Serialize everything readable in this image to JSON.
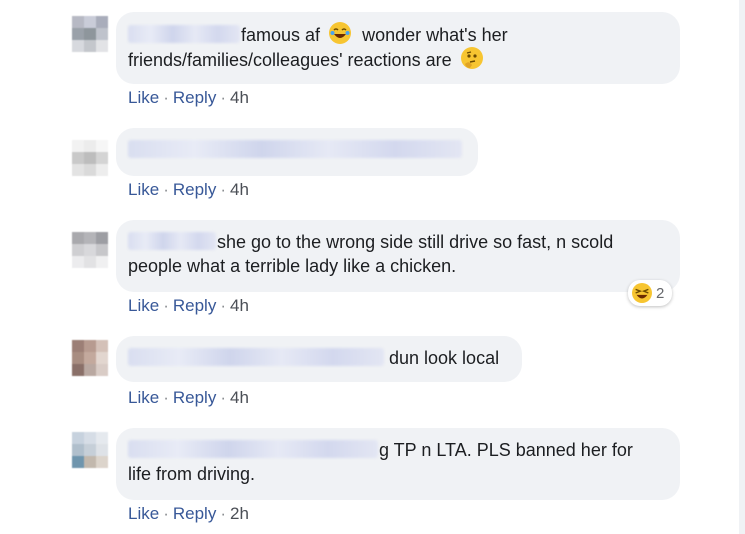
{
  "comments": [
    {
      "text_line1": "famous af",
      "text_line1b": "wonder what's her",
      "text_line2": "friends/families/colleagues' reactions are",
      "like": "Like",
      "reply": "Reply",
      "time": "4h",
      "emoji1": "laughing-tears-icon",
      "emoji2": "thinking-face-icon"
    },
    {
      "text": "",
      "like": "Like",
      "reply": "Reply",
      "time": "4h"
    },
    {
      "text_line1": "she go to the wrong side still drive so fast, n scold",
      "text_line2": "people what a terrible lady like a chicken.",
      "like": "Like",
      "reply": "Reply",
      "time": "4h",
      "reaction_icon": "laughing-face-icon",
      "reaction_count": "2"
    },
    {
      "text_line1": "dun look local",
      "like": "Like",
      "reply": "Reply",
      "time": "4h"
    },
    {
      "text_line1": "g TP n LTA. PLS banned her for",
      "text_line2": "life from driving.",
      "like": "Like",
      "reply": "Reply",
      "time": "2h"
    }
  ],
  "separator": "·",
  "colors": {
    "bubble": "#f0f2f5",
    "link": "#385898",
    "text": "#1c1e21",
    "emoji": "#f7c531"
  }
}
